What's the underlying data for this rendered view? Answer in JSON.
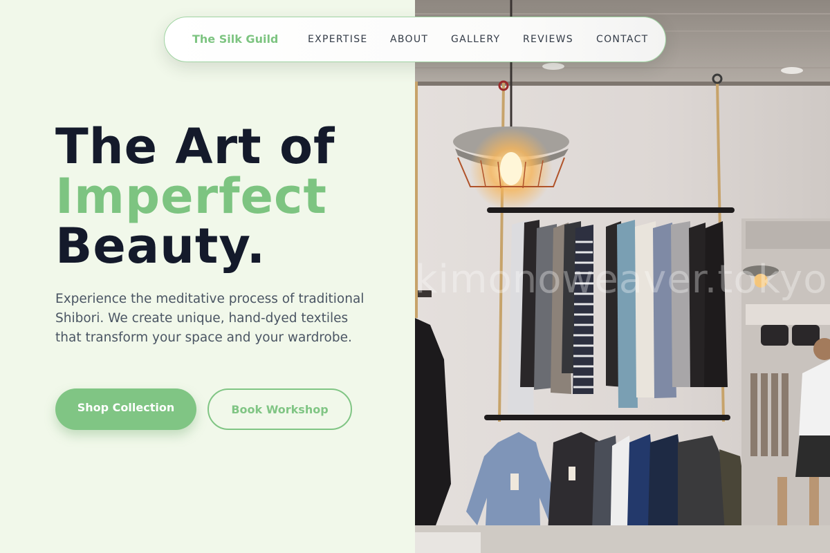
{
  "nav": {
    "brand": "The Silk Guild",
    "links": [
      "EXPERTISE",
      "ABOUT",
      "GALLERY",
      "REVIEWS",
      "CONTACT"
    ]
  },
  "hero": {
    "headline_line1": "The Art of",
    "headline_accent": "Imperfect",
    "headline_line3": "Beauty.",
    "description": "Experience the meditative process of traditional Shibori. We create unique, hand-dyed textiles that transform your space and your wardrobe.",
    "primary_cta": "Shop Collection",
    "secondary_cta": "Book Workshop"
  },
  "photo": {
    "watermark": "kimonoweaver.tokyo"
  },
  "colors": {
    "accent": "#7dc481",
    "headline": "#141a2b",
    "background": "#f1f8ea",
    "body_text": "#4a5563"
  }
}
